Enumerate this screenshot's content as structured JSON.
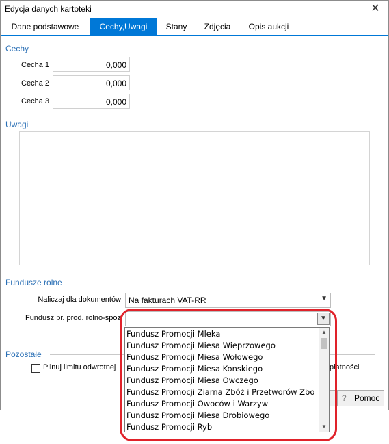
{
  "window": {
    "title": "Edycja danych kartoteki",
    "close_glyph": "✕"
  },
  "tabs": [
    {
      "label": "Dane podstawowe",
      "active": false
    },
    {
      "label": "Cechy,Uwagi",
      "active": true
    },
    {
      "label": "Stany",
      "active": false
    },
    {
      "label": "Zdjęcia",
      "active": false
    },
    {
      "label": "Opis aukcji",
      "active": false
    }
  ],
  "cechy": {
    "title": "Cechy",
    "fields": [
      {
        "label": "Cecha 1",
        "value": "0,000"
      },
      {
        "label": "Cecha 2",
        "value": "0,000"
      },
      {
        "label": "Cecha 3",
        "value": "0,000"
      }
    ]
  },
  "uwagi": {
    "title": "Uwagi",
    "text": ""
  },
  "fundusze": {
    "title": "Fundusze rolne",
    "naliczaj_label": "Naliczaj dla dokumentów",
    "naliczaj_value": "Na fakturach VAT-RR",
    "fundusz_label": "Fundusz pr. prod. rolno-spoż",
    "fundusz_value": "",
    "dropdown_items": [
      "Fundusz Promocji Mleka",
      "Fundusz Promocji Miesa Wieprzowego",
      "Fundusz Promocji Miesa Wołowego",
      "Fundusz Promocji Miesa Konskiego",
      "Fundusz Promocji Miesa Owczego",
      "Fundusz Promocji Ziarna Zbóż i Przetworów Zbo",
      "Fundusz Promocji Owoców i Warzyw",
      "Fundusz Promocji Miesa Drobiowego",
      "Fundusz Promocji Ryb"
    ]
  },
  "pozostale": {
    "title": "Pozostałe",
    "checkbox_label_left": "Pilnuj limitu odwrotnej",
    "checkbox_label_right": "płatności"
  },
  "footer": {
    "help_label": "Pomoc"
  },
  "colors": {
    "accent": "#0078d7",
    "section_text": "#2a6fb5",
    "highlight_ring": "#e0222a"
  }
}
